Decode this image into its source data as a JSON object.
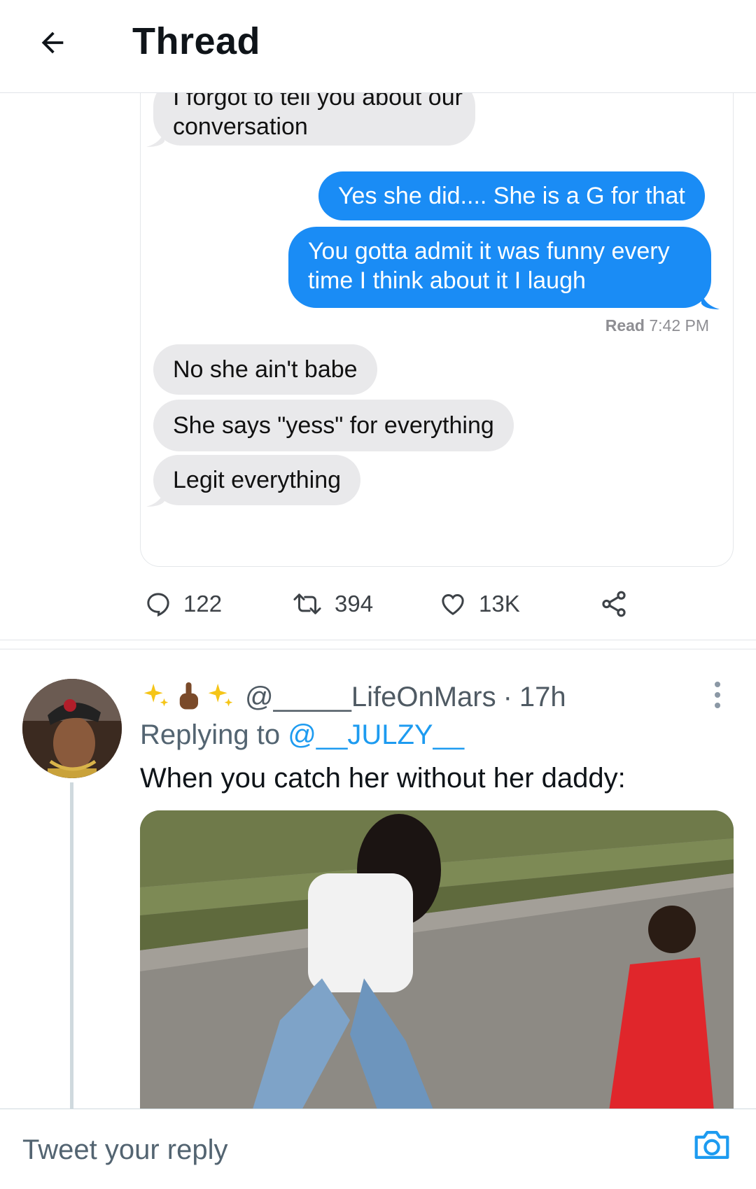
{
  "header": {
    "title": "Thread"
  },
  "screenshot": {
    "messages": [
      {
        "direction": "in",
        "lines": [
          "I forgot to tell you about our",
          "conversation"
        ]
      },
      {
        "direction": "out",
        "lines": [
          "Yes she did.... She is a G for that"
        ]
      },
      {
        "direction": "out",
        "lines": [
          "You gotta admit it was funny every",
          "time I think about it I laugh"
        ]
      },
      {
        "direction": "in",
        "lines": [
          "No she ain't babe"
        ]
      },
      {
        "direction": "in",
        "lines": [
          "She says \"yess\" for everything"
        ]
      },
      {
        "direction": "in",
        "lines": [
          "Legit everything"
        ]
      }
    ],
    "read_label": "Read",
    "read_time": "7:42 PM"
  },
  "actions": {
    "replies": "122",
    "retweets": "394",
    "likes": "13K"
  },
  "reply_tweet": {
    "display_name_emoji": "✨🖕🏾✨",
    "handle": "@_____LifeOnMars",
    "separator": "·",
    "time": "17h",
    "replying_prefix": "Replying to",
    "replying_to": "@__JULZY__",
    "text": "When you catch her without her daddy:"
  },
  "composer": {
    "placeholder": "Tweet your reply"
  },
  "colors": {
    "accent": "#1d9bf0",
    "imessage_blue": "#1a8cf5",
    "incoming_gray": "#e9e9eb"
  }
}
